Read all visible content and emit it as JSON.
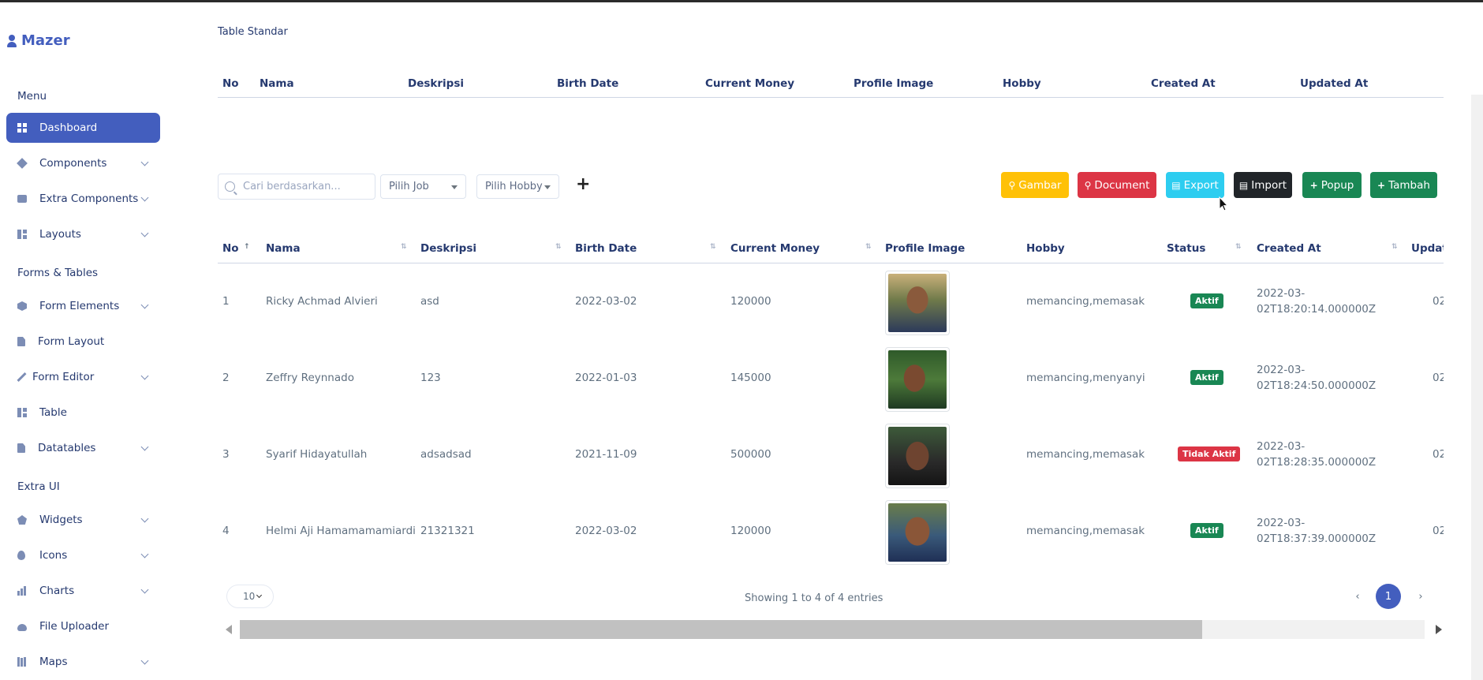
{
  "app": {
    "logo_text": "Mazer"
  },
  "sidebar": {
    "section_menu": "Menu",
    "section_forms": "Forms & Tables",
    "section_extra": "Extra UI",
    "items": [
      {
        "label": "Dashboard",
        "icon": "grid-icon",
        "active": true
      },
      {
        "label": "Components",
        "icon": "stack-icon"
      },
      {
        "label": "Extra Components",
        "icon": "collection-icon"
      },
      {
        "label": "Layouts",
        "icon": "layout-icon"
      },
      {
        "label": "Form Elements",
        "icon": "hexagon-icon"
      },
      {
        "label": "Form Layout",
        "icon": "file-text-icon"
      },
      {
        "label": "Form Editor",
        "icon": "pen-icon"
      },
      {
        "label": "Table",
        "icon": "grid-layout-icon"
      },
      {
        "label": "Datatables",
        "icon": "file-spreadsheet-icon"
      },
      {
        "label": "Widgets",
        "icon": "pentagon-icon"
      },
      {
        "label": "Icons",
        "icon": "droplet-icon"
      },
      {
        "label": "Charts",
        "icon": "bar-chart-icon"
      },
      {
        "label": "File Uploader",
        "icon": "cloud-upload-icon"
      },
      {
        "label": "Maps",
        "icon": "map-icon"
      }
    ]
  },
  "page": {
    "section_title": "Table Standar",
    "standard_columns": [
      "No",
      "Nama",
      "Deskripsi",
      "Birth Date",
      "Current Money",
      "Profile Image",
      "Hobby",
      "Created At",
      "Updated At"
    ]
  },
  "toolbar": {
    "search_placeholder": "Cari berdasarkan...",
    "job_select": "Pilih Job",
    "hobby_select": "Pilih Hobby",
    "add_icon": "+",
    "gambar": "Gambar",
    "document": "Document",
    "export": "Export",
    "import": "Import",
    "popup": "Popup",
    "tambah": "Tambah"
  },
  "datatable": {
    "columns": [
      "No",
      "Nama",
      "Deskripsi",
      "Birth Date",
      "Current Money",
      "Profile Image",
      "Hobby",
      "Status",
      "Created At",
      "Update"
    ],
    "sort_indicator": "↑",
    "rows": [
      {
        "no": "1",
        "nama": "Ricky Achmad Alvieri",
        "deskripsi": "asd",
        "birth": "2022-03-02",
        "money": "120000",
        "hobby": "memancing,memasak",
        "status": "Aktif",
        "created_1": "2022-03-",
        "created_2": "02T18:20:14.000000Z",
        "updated": "02"
      },
      {
        "no": "2",
        "nama": "Zeffry Reynnado",
        "deskripsi": "123",
        "birth": "2022-01-03",
        "money": "145000",
        "hobby": "memancing,menyanyi",
        "status": "Aktif",
        "created_1": "2022-03-",
        "created_2": "02T18:24:50.000000Z",
        "updated": "02"
      },
      {
        "no": "3",
        "nama": "Syarif Hidayatullah",
        "deskripsi": "adsadsad",
        "birth": "2021-11-09",
        "money": "500000",
        "hobby": "memancing,memasak",
        "status": "Tidak Aktif",
        "created_1": "2022-03-",
        "created_2": "02T18:28:35.000000Z",
        "updated": "02"
      },
      {
        "no": "4",
        "nama": "Helmi Aji Hamamamamiardi",
        "deskripsi": "21321321",
        "birth": "2022-03-02",
        "money": "120000",
        "hobby": "memancing,memasak",
        "status": "Aktif",
        "created_1": "2022-03-",
        "created_2": "02T18:37:39.000000Z",
        "updated": "02"
      }
    ],
    "page_length": "10",
    "info": "Showing 1 to 4 of 4 entries",
    "current_page": "1",
    "prev": "‹",
    "next": "›"
  },
  "colors": {
    "primary": "#435ebe",
    "success": "#198754",
    "danger": "#dc3545",
    "warning": "#ffc107",
    "info": "#2dcdf0",
    "dark": "#212529"
  }
}
